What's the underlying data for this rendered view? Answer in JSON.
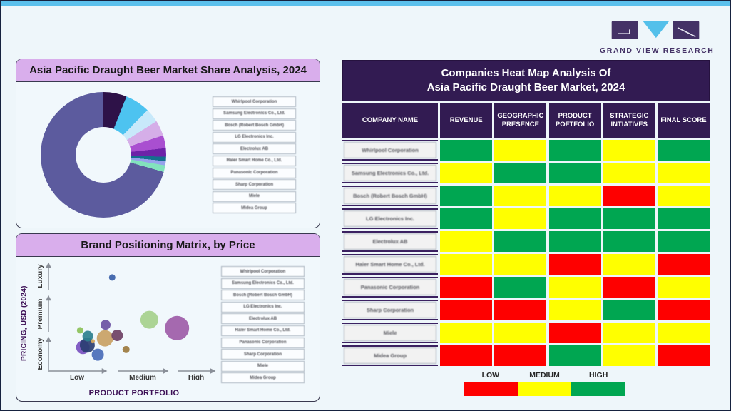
{
  "page": {
    "background": "#eef6fa",
    "top_bar_color": "#5bc0ec",
    "border_color": "#16223f"
  },
  "logo": {
    "brand_text": "GRAND VIEW RESEARCH",
    "purple": "#443266",
    "blue": "#54c0ea"
  },
  "companies": [
    "Whirlpool Corporation",
    "Samsung Electronics Co., Ltd.",
    "Bosch (Robert Bosch GmbH)",
    "LG Electronics Inc.",
    "Electrolux AB",
    "Haier Smart Home Co., Ltd.",
    "Panasonic Corporation",
    "Sharp Corporation",
    "Miele",
    "Midea Group"
  ],
  "share_panel": {
    "title": "Asia Pacific Draught Beer Market Share Analysis, 2024"
  },
  "matrix_panel": {
    "title": "Brand Positioning Matrix, by Price",
    "y_axis_title": "PRICING, USD (2024)",
    "x_axis_title": "PRODUCT PORTFOLIO",
    "y_labels": [
      "Economy",
      "Premium",
      "Luxury"
    ],
    "x_labels": [
      "Low",
      "Medium",
      "High"
    ]
  },
  "heatmap": {
    "title_line1": "Companies Heat Map Analysis Of",
    "title_line2": "Asia Pacific Draught Beer Market, 2024",
    "columns": [
      "COMPANY NAME",
      "REVENUE",
      "GEOGRAPHIC\nPRESENCE",
      "PRODUCT\nPOFTFOLIO",
      "STRATEGIC\nINTIATIVES",
      "FINAL SCORE"
    ],
    "legend": [
      {
        "label": "LOW",
        "color": "#fe0000"
      },
      {
        "label": "MEDIUM",
        "color": "#ffff00"
      },
      {
        "label": "HIGH",
        "color": "#00a651"
      }
    ]
  },
  "chart_data": [
    {
      "type": "pie",
      "title": "Asia Pacific Draught Beer Market Share Analysis, 2024",
      "donut": true,
      "labels": [
        "Whirlpool Corporation",
        "Samsung Electronics Co., Ltd.",
        "Bosch (Robert Bosch GmbH)",
        "LG Electronics Inc.",
        "Electrolux AB",
        "Haier Smart Home Co., Ltd.",
        "Panasonic Corporation",
        "Sharp Corporation",
        "Miele",
        "Midea Group"
      ],
      "values": [
        6.0,
        6.4,
        3.6,
        4.0,
        3.3,
        2.2,
        1.1,
        1.1,
        1.7,
        70.6
      ],
      "colors": [
        "#2e1248",
        "#4dc3f0",
        "#c8e9fa",
        "#d5aee8",
        "#a94fd0",
        "#6d22a8",
        "#146e8e",
        "#96a2ec",
        "#82e2bd",
        "#5c5b9e"
      ],
      "legend_position": "right"
    },
    {
      "type": "scatter",
      "title": "Brand Positioning Matrix, by Price",
      "xlabel": "PRODUCT PORTFOLIO",
      "ylabel": "PRICING, USD (2024)",
      "x_categories": [
        "Low",
        "Medium",
        "High"
      ],
      "y_categories": [
        "Economy",
        "Premium",
        "Luxury"
      ],
      "x_range": [
        0,
        3
      ],
      "y_range": [
        0,
        3
      ],
      "points": [
        {
          "x": 1.82,
          "y": 1.41,
          "r": 12.5,
          "color": "#a6d08c"
        },
        {
          "x": 2.32,
          "y": 1.18,
          "r": 17,
          "color": "#9e5ca8"
        },
        {
          "x": 0.62,
          "y": 0.65,
          "r": 9.5,
          "color": "#7951c0"
        },
        {
          "x": 0.7,
          "y": 0.71,
          "r": 10.5,
          "color": "#2b3e72"
        },
        {
          "x": 1.02,
          "y": 0.9,
          "r": 11.5,
          "color": "#c9a164"
        },
        {
          "x": 0.89,
          "y": 0.45,
          "r": 8.5,
          "color": "#4a6cb8"
        },
        {
          "x": 0.71,
          "y": 0.96,
          "r": 7.5,
          "color": "#2e7f8e"
        },
        {
          "x": 1.24,
          "y": 0.98,
          "r": 8,
          "color": "#6e4064"
        },
        {
          "x": 1.03,
          "y": 1.27,
          "r": 7,
          "color": "#6b51a3"
        },
        {
          "x": 1.15,
          "y": 2.57,
          "r": 4.5,
          "color": "#3a5fa8"
        },
        {
          "x": 0.57,
          "y": 1.12,
          "r": 4.5,
          "color": "#8cc159"
        },
        {
          "x": 0.8,
          "y": 0.82,
          "r": 3,
          "color": "#d8a95e"
        },
        {
          "x": 1.4,
          "y": 0.59,
          "r": 5,
          "color": "#9c7a3e"
        }
      ]
    },
    {
      "type": "heatmap",
      "title": "Companies Heat Map Analysis Of Asia Pacific Draught Beer Market, 2024",
      "rows": [
        "Whirlpool Corporation",
        "Samsung Electronics Co., Ltd.",
        "Bosch (Robert Bosch GmbH)",
        "LG Electronics Inc.",
        "Electrolux AB",
        "Haier Smart Home Co., Ltd.",
        "Panasonic Corporation",
        "Sharp Corporation",
        "Miele",
        "Midea Group"
      ],
      "columns": [
        "REVENUE",
        "GEOGRAPHIC PRESENCE",
        "PRODUCT POFTFOLIO",
        "STRATEGIC INTIATIVES",
        "FINAL SCORE"
      ],
      "values": [
        [
          "high",
          "medium",
          "high",
          "medium",
          "high"
        ],
        [
          "medium",
          "high",
          "high",
          "medium",
          "medium"
        ],
        [
          "high",
          "medium",
          "medium",
          "low",
          "medium"
        ],
        [
          "high",
          "medium",
          "high",
          "high",
          "high"
        ],
        [
          "medium",
          "high",
          "high",
          "high",
          "high"
        ],
        [
          "medium",
          "medium",
          "low",
          "medium",
          "low"
        ],
        [
          "low",
          "high",
          "medium",
          "low",
          "medium"
        ],
        [
          "low",
          "low",
          "medium",
          "high",
          "low"
        ],
        [
          "medium",
          "medium",
          "low",
          "medium",
          "medium"
        ],
        [
          "low",
          "low",
          "high",
          "medium",
          "low"
        ]
      ],
      "palette": {
        "low": "#fe0000",
        "medium": "#ffff00",
        "high": "#00a651"
      }
    }
  ]
}
